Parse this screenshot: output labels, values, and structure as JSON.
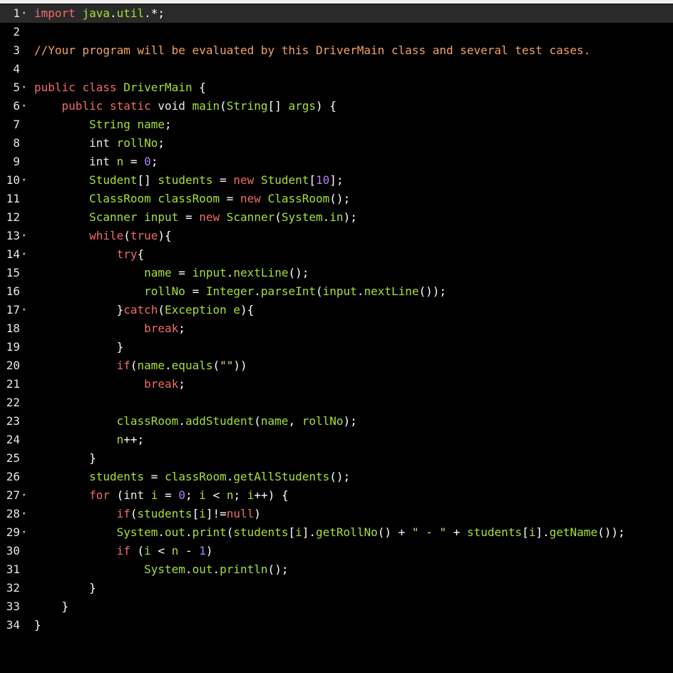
{
  "editor": {
    "language": "java",
    "active_line": 1,
    "lines": [
      {
        "n": "1",
        "fold": true,
        "code": "import java.util.*;"
      },
      {
        "n": "2",
        "fold": false,
        "code": ""
      },
      {
        "n": "3",
        "fold": false,
        "code": "//Your program will be evaluated by this DriverMain class and several test cases."
      },
      {
        "n": "4",
        "fold": false,
        "code": ""
      },
      {
        "n": "5",
        "fold": true,
        "code": "public class DriverMain {"
      },
      {
        "n": "6",
        "fold": true,
        "code": "    public static void main(String[] args) {"
      },
      {
        "n": "7",
        "fold": false,
        "code": "        String name;"
      },
      {
        "n": "8",
        "fold": false,
        "code": "        int rollNo;"
      },
      {
        "n": "9",
        "fold": false,
        "code": "        int n = 0;"
      },
      {
        "n": "10",
        "fold": true,
        "code": "        Student[] students = new Student[10];"
      },
      {
        "n": "11",
        "fold": false,
        "code": "        ClassRoom classRoom = new ClassRoom();"
      },
      {
        "n": "12",
        "fold": false,
        "code": "        Scanner input = new Scanner(System.in);"
      },
      {
        "n": "13",
        "fold": true,
        "code": "        while(true){"
      },
      {
        "n": "14",
        "fold": true,
        "code": "            try{"
      },
      {
        "n": "15",
        "fold": false,
        "code": "                name = input.nextLine();"
      },
      {
        "n": "16",
        "fold": false,
        "code": "                rollNo = Integer.parseInt(input.nextLine());"
      },
      {
        "n": "17",
        "fold": true,
        "code": "            }catch(Exception e){"
      },
      {
        "n": "18",
        "fold": false,
        "code": "                break;"
      },
      {
        "n": "19",
        "fold": false,
        "code": "            }"
      },
      {
        "n": "20",
        "fold": false,
        "code": "            if(name.equals(\"\"))"
      },
      {
        "n": "21",
        "fold": false,
        "code": "                break;"
      },
      {
        "n": "22",
        "fold": false,
        "code": ""
      },
      {
        "n": "23",
        "fold": false,
        "code": "            classRoom.addStudent(name, rollNo);"
      },
      {
        "n": "24",
        "fold": false,
        "code": "            n++;"
      },
      {
        "n": "25",
        "fold": false,
        "code": "        }"
      },
      {
        "n": "26",
        "fold": false,
        "code": "        students = classRoom.getAllStudents();"
      },
      {
        "n": "27",
        "fold": true,
        "code": "        for (int i = 0; i < n; i++) {"
      },
      {
        "n": "28",
        "fold": true,
        "code": "            if(students[i]!=null)"
      },
      {
        "n": "29",
        "fold": true,
        "code": "            System.out.print(students[i].getRollNo() + \" - \" + students[i].getName());"
      },
      {
        "n": "30",
        "fold": false,
        "code": "            if (i < n - 1)"
      },
      {
        "n": "31",
        "fold": false,
        "code": "                System.out.println();"
      },
      {
        "n": "32",
        "fold": false,
        "code": "        }"
      },
      {
        "n": "33",
        "fold": false,
        "code": "    }"
      },
      {
        "n": "34",
        "fold": false,
        "code": "}"
      }
    ]
  },
  "colors": {
    "background": "#000000",
    "active_line": "#2a2a2a",
    "keyword": "#f16a6a",
    "comment": "#f4a261",
    "identifier": "#a6e22e",
    "number": "#ae81ff",
    "string": "#e6db74"
  }
}
